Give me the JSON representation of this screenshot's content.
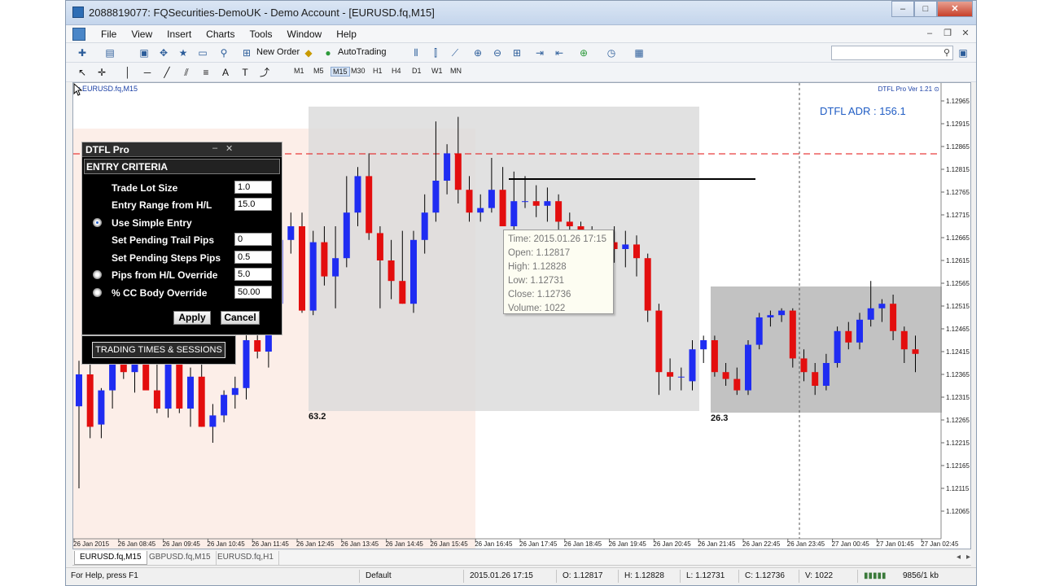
{
  "window": {
    "title": "2088819077: FQSecurities-DemoUK - Demo Account - [EURUSD.fq,M15]",
    "controls": {
      "minimize": "–",
      "maximize": "□",
      "close": "✕"
    }
  },
  "menu": [
    "File",
    "View",
    "Insert",
    "Charts",
    "Tools",
    "Window",
    "Help"
  ],
  "toolbar": {
    "new_order": "New Order",
    "autotrading": "AutoTrading",
    "timeframes": [
      "M1",
      "M5",
      "M15",
      "M30",
      "H1",
      "H4",
      "D1",
      "W1",
      "MN"
    ],
    "active_timeframe": "M15"
  },
  "chart": {
    "symbol_label": "EURUSD.fq,M15",
    "indicator_version": "DTFL Pro Ver 1.21",
    "adr_text": "DTFL ADR : 156.1",
    "block_labels": [
      "63.2",
      "26.3"
    ],
    "price_labels": [
      "1.12965",
      "1.12915",
      "1.12865",
      "1.12815",
      "1.12765",
      "1.12715",
      "1.12665",
      "1.12615",
      "1.12565",
      "1.12515",
      "1.12465",
      "1.12415",
      "1.12365",
      "1.12315",
      "1.12265",
      "1.12215",
      "1.12165",
      "1.12115",
      "1.12065"
    ],
    "time_labels": [
      "26 Jan 2015",
      "26 Jan 08:45",
      "26 Jan 09:45",
      "26 Jan 10:45",
      "26 Jan 11:45",
      "26 Jan 12:45",
      "26 Jan 13:45",
      "26 Jan 14:45",
      "26 Jan 15:45",
      "26 Jan 16:45",
      "26 Jan 17:45",
      "26 Jan 18:45",
      "26 Jan 19:45",
      "26 Jan 20:45",
      "26 Jan 21:45",
      "26 Jan 22:45",
      "26 Jan 23:45",
      "27 Jan 00:45",
      "27 Jan 01:45",
      "27 Jan 02:45"
    ],
    "tooltip": {
      "time": "Time: 2015.01.26 17:15",
      "open": "Open: 1.12817",
      "high": "High: 1.12828",
      "low": "Low:  1.12731",
      "close": "Close: 1.12736",
      "volume": "Volume: 1022"
    },
    "colors": {
      "bull": "#1f2cf2",
      "bear": "#e30e0e",
      "wick": "#000000"
    }
  },
  "panel": {
    "title": "DTFL Pro",
    "section": "ENTRY CRITERIA",
    "rows": [
      {
        "label": "Trade Lot Size",
        "value": "1.0"
      },
      {
        "label": "Entry Range from H/L",
        "value": "15.0"
      },
      {
        "label": "Use Simple Entry",
        "value": "",
        "radio": "selected"
      },
      {
        "label": "Set Pending Trail Pips",
        "value": "0"
      },
      {
        "label": "Set Pending Steps Pips",
        "value": "0.5"
      },
      {
        "label": "Pips from H/L Override",
        "value": "5.0",
        "radio": "unselected"
      },
      {
        "label": "% CC Body Override",
        "value": "50.00",
        "radio": "unselected"
      }
    ],
    "apply": "Apply",
    "cancel": "Cancel",
    "sessions_button": "TRADING TIMES & SESSIONS"
  },
  "tabs": [
    "EURUSD.fq,M15",
    "GBPUSD.fq,M15",
    "EURUSD.fq,H1"
  ],
  "status": {
    "help": "For Help, press F1",
    "profile": "Default",
    "time": "2015.01.26 17:15",
    "open": "O: 1.12817",
    "high": "H: 1.12828",
    "low": "L: 1.12731",
    "close": "C: 1.12736",
    "volume": "V: 1022",
    "traffic": "9856/1 kb"
  },
  "chart_data": {
    "type": "candlestick",
    "ylim": [
      1.12065,
      1.12965
    ],
    "candles": [
      {
        "o": 1.12295,
        "h": 1.12395,
        "l": 1.12115,
        "c": 1.12365
      },
      {
        "o": 1.12365,
        "h": 1.12395,
        "l": 1.12225,
        "c": 1.1225
      },
      {
        "o": 1.12255,
        "h": 1.12335,
        "l": 1.12225,
        "c": 1.1233
      },
      {
        "o": 1.1233,
        "h": 1.1241,
        "l": 1.1229,
        "c": 1.124
      },
      {
        "o": 1.124,
        "h": 1.12425,
        "l": 1.12355,
        "c": 1.1237
      },
      {
        "o": 1.1237,
        "h": 1.1243,
        "l": 1.12325,
        "c": 1.1242
      },
      {
        "o": 1.1242,
        "h": 1.12445,
        "l": 1.1236,
        "c": 1.1233
      },
      {
        "o": 1.1233,
        "h": 1.1239,
        "l": 1.1228,
        "c": 1.1229
      },
      {
        "o": 1.1229,
        "h": 1.1243,
        "l": 1.1227,
        "c": 1.1242
      },
      {
        "o": 1.1242,
        "h": 1.12435,
        "l": 1.1228,
        "c": 1.1229
      },
      {
        "o": 1.1229,
        "h": 1.1238,
        "l": 1.1225,
        "c": 1.1236
      },
      {
        "o": 1.1236,
        "h": 1.1239,
        "l": 1.1225,
        "c": 1.1225
      },
      {
        "o": 1.1225,
        "h": 1.123,
        "l": 1.12215,
        "c": 1.12275
      },
      {
        "o": 1.12275,
        "h": 1.1233,
        "l": 1.1226,
        "c": 1.1232
      },
      {
        "o": 1.1232,
        "h": 1.1236,
        "l": 1.1229,
        "c": 1.12335
      },
      {
        "o": 1.12335,
        "h": 1.1246,
        "l": 1.1231,
        "c": 1.1244
      },
      {
        "o": 1.1244,
        "h": 1.1248,
        "l": 1.124,
        "c": 1.12415
      },
      {
        "o": 1.12415,
        "h": 1.1254,
        "l": 1.1238,
        "c": 1.1252
      },
      {
        "o": 1.1252,
        "h": 1.1276,
        "l": 1.125,
        "c": 1.1266
      },
      {
        "o": 1.1266,
        "h": 1.1272,
        "l": 1.1263,
        "c": 1.1269
      },
      {
        "o": 1.1269,
        "h": 1.1272,
        "l": 1.125,
        "c": 1.12505
      },
      {
        "o": 1.12505,
        "h": 1.1268,
        "l": 1.12495,
        "c": 1.12655
      },
      {
        "o": 1.12655,
        "h": 1.1269,
        "l": 1.1256,
        "c": 1.1258
      },
      {
        "o": 1.1258,
        "h": 1.1269,
        "l": 1.1251,
        "c": 1.1262
      },
      {
        "o": 1.1262,
        "h": 1.128,
        "l": 1.126,
        "c": 1.1272
      },
      {
        "o": 1.1272,
        "h": 1.1282,
        "l": 1.1269,
        "c": 1.128
      },
      {
        "o": 1.128,
        "h": 1.1285,
        "l": 1.1266,
        "c": 1.12675
      },
      {
        "o": 1.12675,
        "h": 1.1269,
        "l": 1.1251,
        "c": 1.12615
      },
      {
        "o": 1.12615,
        "h": 1.1266,
        "l": 1.1253,
        "c": 1.1257
      },
      {
        "o": 1.1257,
        "h": 1.1268,
        "l": 1.1252,
        "c": 1.1252
      },
      {
        "o": 1.1252,
        "h": 1.1268,
        "l": 1.125,
        "c": 1.1266
      },
      {
        "o": 1.1266,
        "h": 1.1276,
        "l": 1.1263,
        "c": 1.1272
      },
      {
        "o": 1.1272,
        "h": 1.1292,
        "l": 1.127,
        "c": 1.1279
      },
      {
        "o": 1.1279,
        "h": 1.1287,
        "l": 1.1276,
        "c": 1.1285
      },
      {
        "o": 1.1285,
        "h": 1.1293,
        "l": 1.1274,
        "c": 1.1277
      },
      {
        "o": 1.1277,
        "h": 1.128,
        "l": 1.127,
        "c": 1.1272
      },
      {
        "o": 1.1272,
        "h": 1.1276,
        "l": 1.127,
        "c": 1.1273
      },
      {
        "o": 1.1273,
        "h": 1.1284,
        "l": 1.1272,
        "c": 1.1277
      },
      {
        "o": 1.1277,
        "h": 1.1282,
        "l": 1.1271,
        "c": 1.1269
      },
      {
        "o": 1.1269,
        "h": 1.1281,
        "l": 1.1268,
        "c": 1.12745
      },
      {
        "o": 1.12745,
        "h": 1.128,
        "l": 1.1273,
        "c": 1.12745
      },
      {
        "o": 1.12745,
        "h": 1.1278,
        "l": 1.1271,
        "c": 1.12735
      },
      {
        "o": 1.12735,
        "h": 1.12775,
        "l": 1.127,
        "c": 1.12745
      },
      {
        "o": 1.12745,
        "h": 1.1276,
        "l": 1.1268,
        "c": 1.127
      },
      {
        "o": 1.127,
        "h": 1.1272,
        "l": 1.1266,
        "c": 1.1269
      },
      {
        "o": 1.1269,
        "h": 1.127,
        "l": 1.1264,
        "c": 1.1265
      },
      {
        "o": 1.1265,
        "h": 1.1269,
        "l": 1.1263,
        "c": 1.12635
      },
      {
        "o": 1.12635,
        "h": 1.1267,
        "l": 1.1261,
        "c": 1.12655
      },
      {
        "o": 1.12655,
        "h": 1.1269,
        "l": 1.1261,
        "c": 1.1264
      },
      {
        "o": 1.1264,
        "h": 1.1268,
        "l": 1.126,
        "c": 1.1265
      },
      {
        "o": 1.1265,
        "h": 1.1267,
        "l": 1.1258,
        "c": 1.1262
      },
      {
        "o": 1.1262,
        "h": 1.1263,
        "l": 1.1248,
        "c": 1.12505
      },
      {
        "o": 1.12505,
        "h": 1.1252,
        "l": 1.1232,
        "c": 1.1237
      },
      {
        "o": 1.1237,
        "h": 1.124,
        "l": 1.1233,
        "c": 1.1236
      },
      {
        "o": 1.1236,
        "h": 1.1238,
        "l": 1.1233,
        "c": 1.1236
      },
      {
        "o": 1.1235,
        "h": 1.1244,
        "l": 1.1233,
        "c": 1.1242
      },
      {
        "o": 1.1242,
        "h": 1.1245,
        "l": 1.1239,
        "c": 1.1244
      },
      {
        "o": 1.1244,
        "h": 1.1245,
        "l": 1.1236,
        "c": 1.1237
      },
      {
        "o": 1.1237,
        "h": 1.1239,
        "l": 1.1234,
        "c": 1.12355
      },
      {
        "o": 1.12355,
        "h": 1.1238,
        "l": 1.1232,
        "c": 1.1233
      },
      {
        "o": 1.1233,
        "h": 1.1244,
        "l": 1.1232,
        "c": 1.1243
      },
      {
        "o": 1.1243,
        "h": 1.125,
        "l": 1.1242,
        "c": 1.1249
      },
      {
        "o": 1.1249,
        "h": 1.12505,
        "l": 1.1247,
        "c": 1.12495
      },
      {
        "o": 1.12495,
        "h": 1.1251,
        "l": 1.1248,
        "c": 1.12505
      },
      {
        "o": 1.12505,
        "h": 1.1251,
        "l": 1.1238,
        "c": 1.124
      },
      {
        "o": 1.124,
        "h": 1.1242,
        "l": 1.1235,
        "c": 1.1237
      },
      {
        "o": 1.1237,
        "h": 1.1239,
        "l": 1.1232,
        "c": 1.1234
      },
      {
        "o": 1.1234,
        "h": 1.1241,
        "l": 1.1233,
        "c": 1.1239
      },
      {
        "o": 1.1239,
        "h": 1.1247,
        "l": 1.1238,
        "c": 1.1246
      },
      {
        "o": 1.1246,
        "h": 1.1248,
        "l": 1.1242,
        "c": 1.12435
      },
      {
        "o": 1.12435,
        "h": 1.125,
        "l": 1.1242,
        "c": 1.12485
      },
      {
        "o": 1.12485,
        "h": 1.1257,
        "l": 1.1247,
        "c": 1.1251
      },
      {
        "o": 1.1251,
        "h": 1.1253,
        "l": 1.1248,
        "c": 1.1252
      },
      {
        "o": 1.1252,
        "h": 1.1254,
        "l": 1.1244,
        "c": 1.1246
      },
      {
        "o": 1.1246,
        "h": 1.1247,
        "l": 1.1239,
        "c": 1.1242
      },
      {
        "o": 1.1242,
        "h": 1.1245,
        "l": 1.1237,
        "c": 1.1241
      }
    ]
  }
}
